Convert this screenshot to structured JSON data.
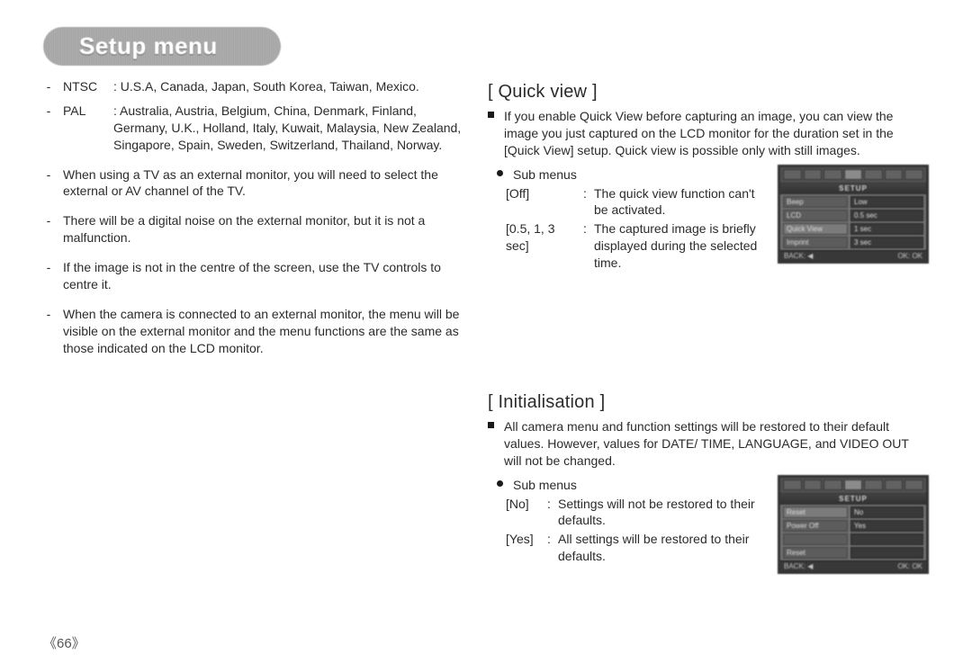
{
  "title": "Setup menu",
  "page_number": "《66》",
  "left": {
    "video_standards": [
      {
        "code": "NTSC",
        "countries": "U.S.A, Canada, Japan, South Korea, Taiwan, Mexico."
      },
      {
        "code": "PAL",
        "countries": "Australia, Austria, Belgium, China, Denmark, Finland, Germany, U.K., Holland, Italy, Kuwait, Malaysia, New Zealand, Singapore, Spain, Sweden, Switzerland, Thailand, Norway."
      }
    ],
    "notes": [
      "When using a TV as an external monitor, you will need to select the external or AV channel of the TV.",
      "There will be a digital noise on the external monitor, but it is not a malfunction.",
      "If the image is not in the centre of the screen, use the TV controls to centre it.",
      "When the camera is connected to an external monitor, the menu will be visible on the external monitor and the menu functions are the same as those indicated on the LCD monitor."
    ]
  },
  "quickview": {
    "heading": "[ Quick view ]",
    "intro": "If you enable Quick View before capturing an image, you can view the image you just captured on the LCD monitor for the duration set in the [Quick View] setup. Quick view is possible only with still images.",
    "sub_label": "Sub menus",
    "subs": [
      {
        "term": "[Off]",
        "desc": "The quick view function can't be activated."
      },
      {
        "term": "[0.5, 1, 3 sec]",
        "desc": "The captured image is briefly displayed during the selected time."
      }
    ],
    "lcd": {
      "ribbon": "SETUP",
      "rows": [
        {
          "k": "Beep",
          "v": "Low"
        },
        {
          "k": "LCD",
          "v": "0.5 sec"
        },
        {
          "k": "Quick View",
          "v": "1 sec"
        },
        {
          "k": "Imprint",
          "v": "3 sec"
        }
      ],
      "back": "BACK: ◀",
      "ok": "OK: OK"
    }
  },
  "init": {
    "heading": "[ Initialisation ]",
    "intro": "All camera menu and function settings will be restored to their default values. However, values for DATE/ TIME, LANGUAGE, and VIDEO OUT will not be changed.",
    "sub_label": "Sub menus",
    "subs": [
      {
        "term": "[No]",
        "desc": "Settings will not be restored to their defaults."
      },
      {
        "term": "[Yes]",
        "desc": "All settings will be restored to their defaults."
      }
    ],
    "lcd": {
      "ribbon": "SETUP",
      "rows": [
        {
          "k": "Reset",
          "v": "No"
        },
        {
          "k": "Power Off",
          "v": "Yes"
        },
        {
          "k": "",
          "v": ""
        },
        {
          "k": "Reset",
          "v": ""
        }
      ],
      "back": "BACK: ◀",
      "ok": "OK: OK"
    }
  }
}
